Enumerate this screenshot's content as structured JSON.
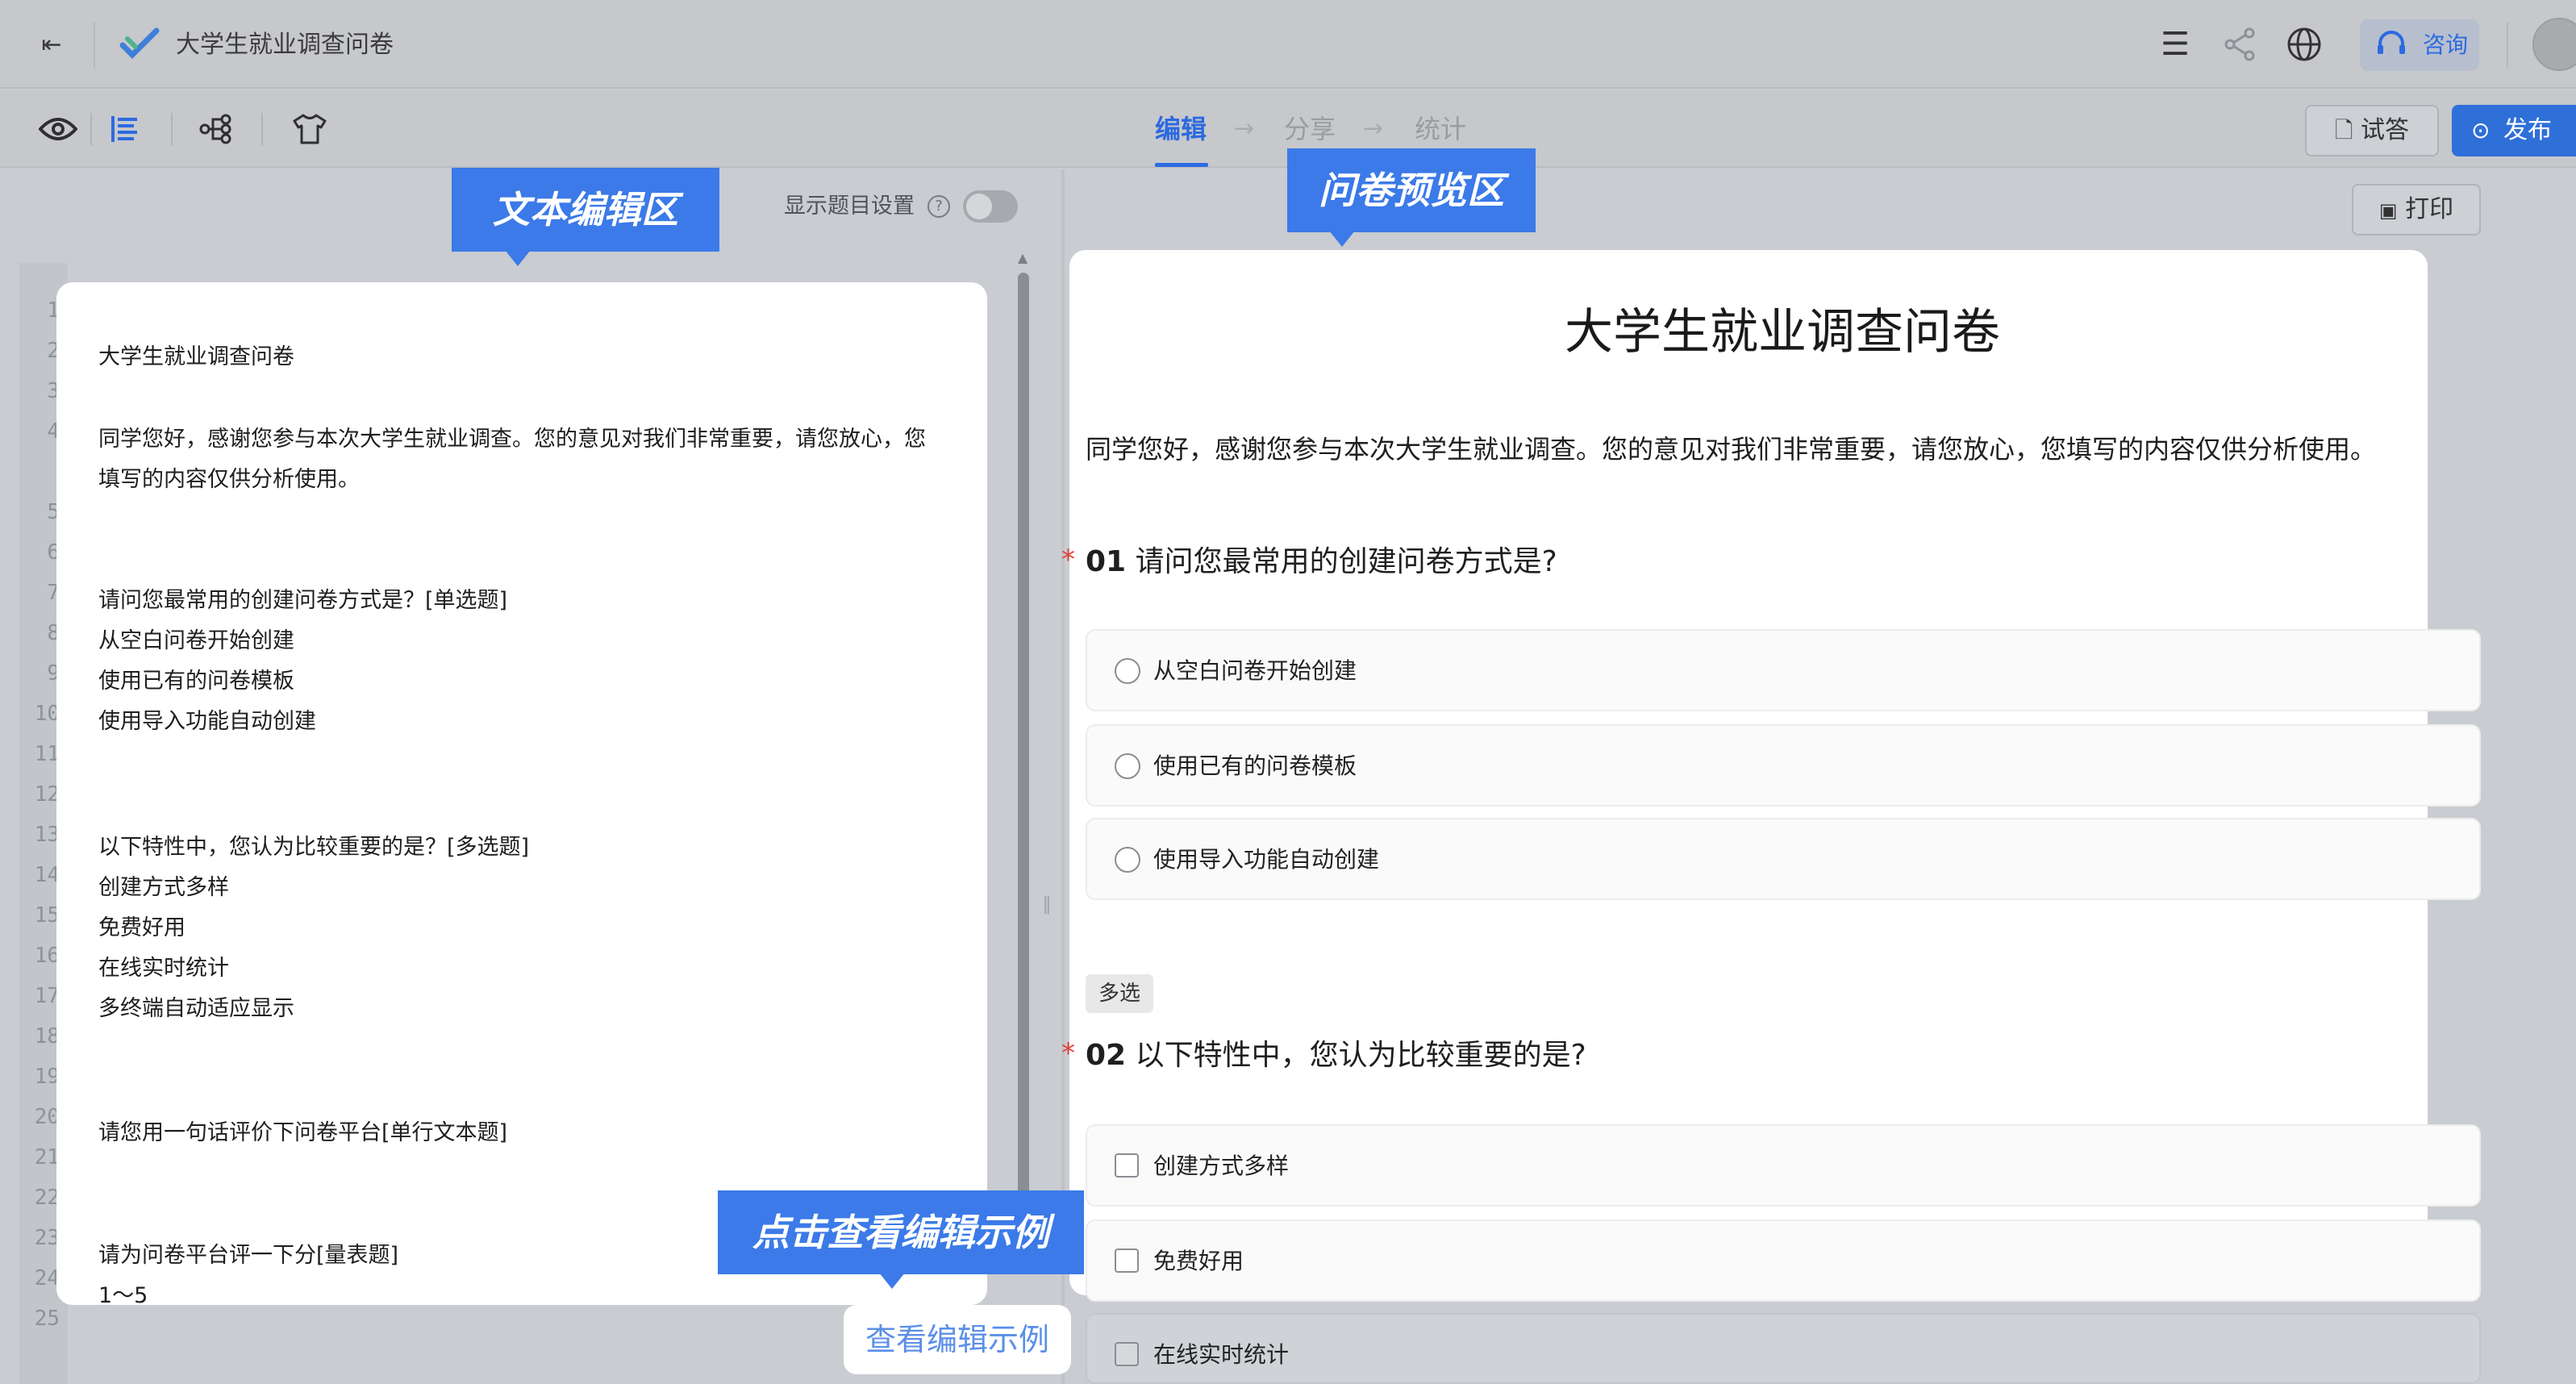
{
  "topbar": {
    "back_icon": "logout-arrow-icon",
    "app_title": "大学生就业调查问卷",
    "consult_label": "咨询",
    "icons": [
      "menu-icon",
      "share-icon",
      "globe-icon",
      "headset-icon",
      "avatar"
    ]
  },
  "toolbar": {
    "tools": [
      "eye-icon",
      "list-icon",
      "flow-icon",
      "tshirt-icon"
    ],
    "steps": [
      "编辑",
      "分享",
      "统计"
    ],
    "try_label": "试答",
    "publish_label": "发布"
  },
  "editor": {
    "show_settings_label": "显示题目设置",
    "line_numbers": [
      "1",
      "2",
      "3",
      "4",
      "5",
      "6",
      "7",
      "8",
      "9",
      "10",
      "11",
      "12",
      "13",
      "14",
      "15",
      "16",
      "17",
      "18",
      "19",
      "20",
      "21",
      "22",
      "23",
      "24",
      "25"
    ],
    "lines": [
      "大学生就业调查问卷",
      "同学您好，感谢您参与本次大学生就业调查。您的意见对我们非常重要，请您放心，您",
      "填写的内容仅供分析使用。",
      "请问您最常用的创建问卷方式是？[单选题]",
      "从空白问卷开始创建",
      "使用已有的问卷模板",
      "使用导入功能自动创建",
      "以下特性中，您认为比较重要的是？[多选题]",
      "创建方式多样",
      "免费好用",
      "在线实时统计",
      "多终端自动适应显示",
      "请您用一句话评价下问卷平台[单行文本题]",
      "请为问卷平台评一下分[量表题]",
      "1～5"
    ]
  },
  "preview": {
    "print_label": "打印",
    "title": "大学生就业调查问卷",
    "intro": "同学您好，感谢您参与本次大学生就业调查。您的意见对我们非常重要，请您放心，您填写的内容仅供分析使用。",
    "q1": {
      "number": "01",
      "text": "请问您最常用的创建问卷方式是?",
      "options": [
        "从空白问卷开始创建",
        "使用已有的问卷模板",
        "使用导入功能自动创建"
      ]
    },
    "q2": {
      "tag": "多选",
      "number": "02",
      "text": "以下特性中，您认为比较重要的是?",
      "options": [
        "创建方式多样",
        "免费好用",
        "在线实时统计"
      ]
    }
  },
  "callouts": {
    "editor_area": "文本编辑区",
    "preview_area": "问卷预览区",
    "click_example": "点击查看编辑示例",
    "view_example_button": "查看编辑示例"
  },
  "colors": {
    "accent": "#2d6ae0",
    "callout": "#3b7ae8",
    "required": "#e2403a"
  }
}
